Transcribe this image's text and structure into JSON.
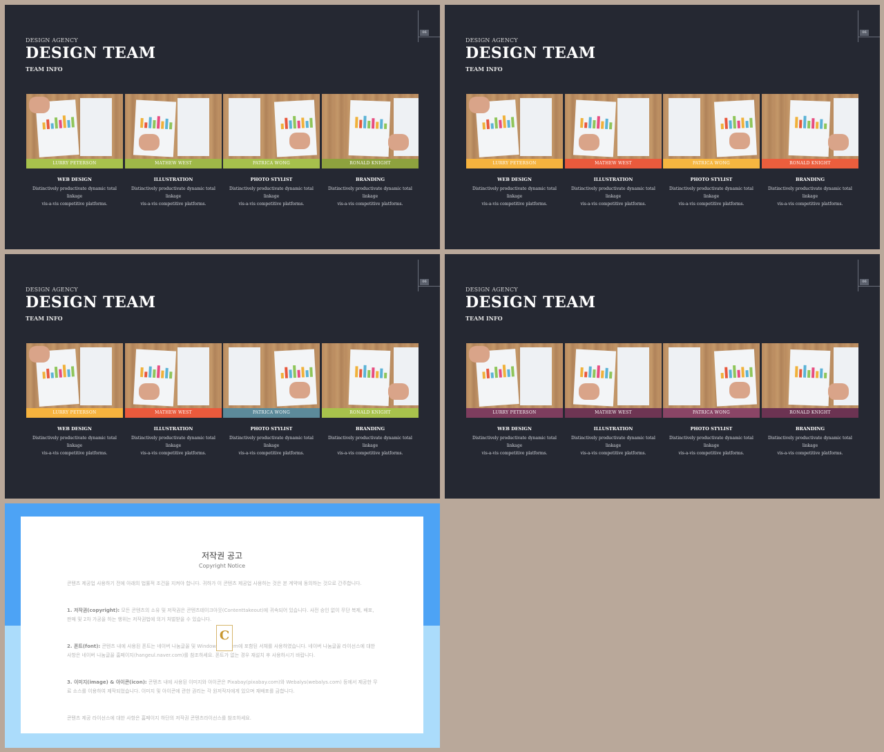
{
  "slides": [
    {
      "agency": "DESIGN AGENCY",
      "title": "DESIGN TEAM",
      "subtitle": "TEAM INFO",
      "page_number": "06",
      "band_colors": [
        "#a8c24c",
        "#9fb848",
        "#a6c04c",
        "#8ea23e"
      ],
      "members": [
        {
          "name": "LURRY PETERSON",
          "role": "WEB DESIGN",
          "desc_line1": "Distinctively productivate dynamic total linkage",
          "desc_line2": "vis-a-vis competitive platforms."
        },
        {
          "name": "MATHEW WEST",
          "role": "ILLUSTRATION",
          "desc_line1": "Distinctively productivate dynamic total linkage",
          "desc_line2": "vis-a-vis competitive platforms."
        },
        {
          "name": "PATRICA WONG",
          "role": "PHOTO STYLIST",
          "desc_line1": "Distinctively productivate dynamic total linkage",
          "desc_line2": "vis-a-vis competitive platforms."
        },
        {
          "name": "RONALD  KNIGHT",
          "role": "BRANDING",
          "desc_line1": "Distinctively productivate dynamic total linkage",
          "desc_line2": "vis-a-vis competitive platforms."
        }
      ]
    },
    {
      "agency": "DESIGN AGENCY",
      "title": "DESIGN TEAM",
      "subtitle": "TEAM INFO",
      "page_number": "06",
      "band_colors": [
        "#f6b33e",
        "#ea5a3c",
        "#f6b640",
        "#eb5e3d"
      ],
      "members": [
        {
          "name": "LURRY PETERSON",
          "role": "WEB DESIGN",
          "desc_line1": "Distinctively productivate dynamic total linkage",
          "desc_line2": "vis-a-vis competitive platforms."
        },
        {
          "name": "MATHEW WEST",
          "role": "ILLUSTRATION",
          "desc_line1": "Distinctively productivate dynamic total linkage",
          "desc_line2": "vis-a-vis competitive platforms."
        },
        {
          "name": "PATRICA WONG",
          "role": "PHOTO STYLIST",
          "desc_line1": "Distinctively productivate dynamic total linkage",
          "desc_line2": "vis-a-vis competitive platforms."
        },
        {
          "name": "RONALD  KNIGHT",
          "role": "BRANDING",
          "desc_line1": "Distinctively productivate dynamic total linkage",
          "desc_line2": "vis-a-vis competitive platforms."
        }
      ]
    },
    {
      "agency": "DESIGN AGENCY",
      "title": "DESIGN TEAM",
      "subtitle": "TEAM INFO",
      "page_number": "06",
      "band_colors": [
        "#f6b33e",
        "#ea5a3c",
        "#5c8a9a",
        "#a8c24c"
      ],
      "members": [
        {
          "name": "LURRY PETERSON",
          "role": "WEB DESIGN",
          "desc_line1": "Distinctively productivate dynamic total linkage",
          "desc_line2": "vis-a-vis competitive platforms."
        },
        {
          "name": "MATHEW WEST",
          "role": "ILLUSTRATION",
          "desc_line1": "Distinctively productivate dynamic total linkage",
          "desc_line2": "vis-a-vis competitive platforms."
        },
        {
          "name": "PATRICA WONG",
          "role": "PHOTO STYLIST",
          "desc_line1": "Distinctively productivate dynamic total linkage",
          "desc_line2": "vis-a-vis competitive platforms."
        },
        {
          "name": "RONALD  KNIGHT",
          "role": "BRANDING",
          "desc_line1": "Distinctively productivate dynamic total linkage",
          "desc_line2": "vis-a-vis competitive platforms."
        }
      ]
    },
    {
      "agency": "DESIGN AGENCY",
      "title": "DESIGN TEAM",
      "subtitle": "TEAM INFO",
      "page_number": "06",
      "band_colors": [
        "#7e3d5e",
        "#6e3553",
        "#8a4566",
        "#6c3352"
      ],
      "members": [
        {
          "name": "LURRY PETERSON",
          "role": "WEB DESIGN",
          "desc_line1": "Distinctively productivate dynamic total linkage",
          "desc_line2": "vis-a-vis competitive platforms."
        },
        {
          "name": "MATHEW WEST",
          "role": "ILLUSTRATION",
          "desc_line1": "Distinctively productivate dynamic total linkage",
          "desc_line2": "vis-a-vis competitive platforms."
        },
        {
          "name": "PATRICA WONG",
          "role": "PHOTO STYLIST",
          "desc_line1": "Distinctively productivate dynamic total linkage",
          "desc_line2": "vis-a-vis competitive platforms."
        },
        {
          "name": "RONALD  KNIGHT",
          "role": "BRANDING",
          "desc_line1": "Distinctively productivate dynamic total linkage",
          "desc_line2": "vis-a-vis competitive platforms."
        }
      ]
    }
  ],
  "copyright": {
    "title": "저작권 공고",
    "subtitle": "Copyright Notice",
    "logo_letter": "C",
    "intro": "콘텐츠 제공업 사용하기 전에 아래의 법률적 조건을 지켜야 합니다. 귀하가 이 콘텐츠 제공업 사용하는 것은 본 계약에 동의하는 것으로 간주합니다.",
    "sections": [
      {
        "label": "1. 저작권(copyright):",
        "text": " 모든 콘텐츠의 소유 및 저작권은 콘텐츠테이크아웃(Contenttakeout)에 귀속되어 있습니다. 사전 승인 없이 무단 복제, 배포, 판매 및 2차 가공을 하는 행위는 저작권법에 의거 처벌받을 수 있습니다."
      },
      {
        "label": "2. 폰트(font):",
        "text": " 콘텐츠 내에 사용된 폰트는 네이버 나눔글꼴 및 Windows System에 포함된 서체를 사용하였습니다. 네이버 나눔글꼴 라이선스에 대한 사항은 네이버 나눔글꼴 홈페이지(hangeul.naver.com)를 참조하세요. 폰트가 없는 경우 재설치 후 사용하시기 바랍니다."
      },
      {
        "label": "3. 이미지(image) & 아이콘(icon):",
        "text": " 콘텐츠 내에 사용된 이미지와 아이콘은 Pixabay(pixabay.com)와 Webalys(webalys.com) 등에서 제공한 무료 소스를 이용하여 제작되었습니다. 이미지 및 아이콘에 관한 권리는 각 원저작자에게 있으며 재배포를 금합니다."
      }
    ],
    "outro": "콘텐츠 제공 라이선스에 대한 사항은 홈페이지 하단의 저작권 콘텐츠라이선스를 참조하세요."
  }
}
